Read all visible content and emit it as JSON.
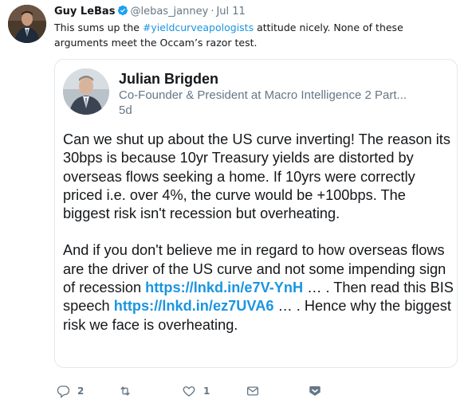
{
  "tweet": {
    "author_name": "Guy LeBas",
    "author_handle": "@lebas_janney",
    "separator": "·",
    "timestamp": "Jul 11",
    "text_before": "This sums up the ",
    "hashtag": "#yieldcurveapologists",
    "text_after": " attitude nicely.  None of these arguments meet the Occam’s razor test.",
    "verified": true
  },
  "quoted": {
    "author_name": "Julian Brigden",
    "author_subtitle": "Co-Founder & President at Macro Intelligence 2 Part...",
    "timestamp": "5d",
    "paragraph1": "Can we shut up about the US curve inverting! The reason its 30bps is because 10yr Treasury yields are distorted by overseas flows seeking a home. If 10yrs were correctly priced i.e. over 4%, the curve would be +100bps. The biggest risk isn't recession but overheating.",
    "p2_text1": "And if you don't believe me in regard to how overseas flows are the driver of the US curve and not some impending sign of recession ",
    "p2_link1": "https://lnkd.in/e7V-YnH",
    "p2_text2": " … . Then read this BIS speech ",
    "p2_link2": "https://lnkd.in/ez7UVA6",
    "p2_text3": " … . Hence why the biggest risk we face is overheating."
  },
  "actions": {
    "reply_count": "2",
    "retweet_count": "",
    "like_count": "1"
  },
  "colors": {
    "link": "#1b95e0",
    "muted": "#657786",
    "verified": "#1da1f2",
    "border": "#e1e8ed"
  },
  "icons": [
    "verified-badge-icon",
    "reply-icon",
    "retweet-icon",
    "like-icon",
    "direct-message-icon",
    "more-chevron-icon"
  ]
}
